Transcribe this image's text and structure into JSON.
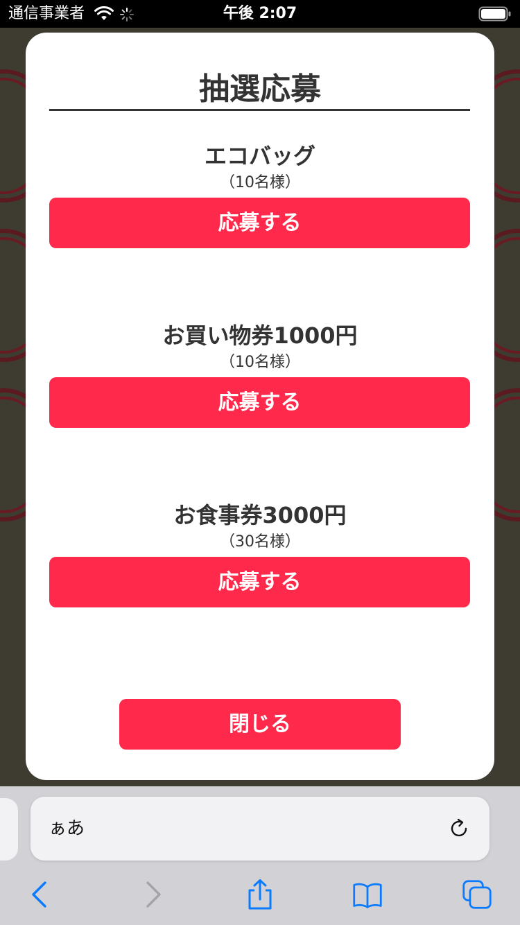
{
  "status_bar": {
    "carrier": "通信事業者",
    "time": "午後 2:07",
    "icons": [
      "wifi-icon",
      "activity-spinner-icon",
      "battery-icon"
    ]
  },
  "modal": {
    "title": "抽選応募",
    "prizes": [
      {
        "name": "エコバッグ",
        "count": "（10名様）",
        "button_label": "応募する"
      },
      {
        "name": "お買い物券1000円",
        "count": "（10名様）",
        "button_label": "応募する"
      },
      {
        "name": "お食事券3000円",
        "count": "（30名様）",
        "button_label": "応募する"
      }
    ],
    "close_label": "閉じる"
  },
  "browser": {
    "address_label": "ぁあ",
    "toolbar_icons": [
      "back-icon",
      "forward-icon",
      "share-icon",
      "bookmarks-icon",
      "tabs-icon"
    ],
    "reload_icon": "reload-icon"
  },
  "colors": {
    "accent": "#ff2a4b",
    "text": "#333333",
    "ios_blue": "#0a7aff"
  }
}
